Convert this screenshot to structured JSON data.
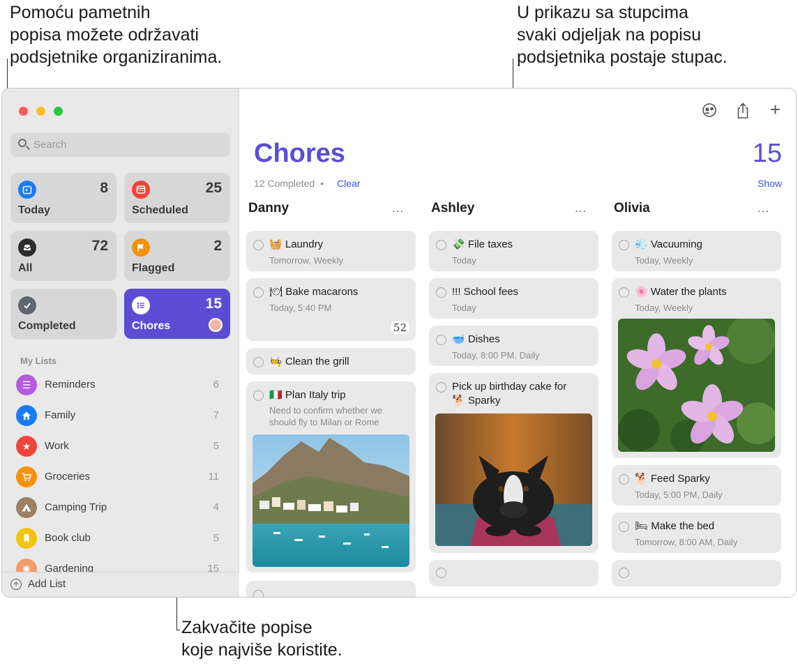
{
  "callouts": {
    "top_left": "Pomoću pametnih\npopisa možete održavati\npodsjetnike organiziranima.",
    "top_right": "U prikazu sa stupcima\nsvaki odjeljak na popisu\npodsjetnika postaje stupac.",
    "bottom": "Zakvačite popise\nkoje najviše koristite."
  },
  "sidebar": {
    "search_placeholder": "Search",
    "smart_lists": [
      {
        "label": "Today",
        "count": "8",
        "icon": "calendar-icon",
        "color": "#1a7cf5"
      },
      {
        "label": "Scheduled",
        "count": "25",
        "icon": "calendar-grid-icon",
        "color": "#f0443a"
      },
      {
        "label": "All",
        "count": "72",
        "icon": "tray-icon",
        "color": "#2c2c2e"
      },
      {
        "label": "Flagged",
        "count": "2",
        "icon": "flag-icon",
        "color": "#f5910a"
      },
      {
        "label": "Completed",
        "count": "",
        "icon": "checkmark-icon",
        "color": "#5e6670"
      },
      {
        "label": "Chores",
        "count": "15",
        "icon": "list-icon",
        "color": "#5b4dd3"
      }
    ],
    "my_lists_header": "My Lists",
    "lists": [
      {
        "name": "Reminders",
        "count": "6",
        "icon": "bullet-list-icon",
        "color": "#b45be0"
      },
      {
        "name": "Family",
        "count": "7",
        "icon": "house-icon",
        "color": "#1a7cf5"
      },
      {
        "name": "Work",
        "count": "5",
        "icon": "star-icon",
        "color": "#f0443a"
      },
      {
        "name": "Groceries",
        "count": "11",
        "icon": "cart-icon",
        "color": "#f5910a"
      },
      {
        "name": "Camping Trip",
        "count": "4",
        "icon": "tent-icon",
        "color": "#9a8262"
      },
      {
        "name": "Book club",
        "count": "5",
        "icon": "bookmark-icon",
        "color": "#f5c40a"
      },
      {
        "name": "Gardening",
        "count": "15",
        "icon": "sun-icon",
        "color": "#f29d6b"
      }
    ],
    "add_list": "Add List"
  },
  "main": {
    "title": "Chores",
    "total": "15",
    "completed_text": "12 Completed",
    "separator": "•",
    "clear": "Clear",
    "show": "Show",
    "columns": [
      {
        "name": "Danny",
        "more": "...",
        "items": [
          {
            "emoji": "🧺",
            "title": "Laundry",
            "sub": "Tomorrow, Weekly"
          },
          {
            "emoji": "🍽",
            "title": "Bake macarons",
            "sub": "Today, 5:40 PM",
            "badge": "52"
          },
          {
            "emoji": "🧑‍🍳",
            "title": "Clean the grill",
            "sub": ""
          },
          {
            "emoji": "🇮🇹",
            "title": "Plan Italy trip",
            "sub": "Need to confirm whether we should fly to Milan or Rome"
          }
        ]
      },
      {
        "name": "Ashley",
        "more": "...",
        "items": [
          {
            "emoji": "💸",
            "title": "File taxes",
            "sub": "Today"
          },
          {
            "emoji": "",
            "title": "!!! School fees",
            "sub": "Today"
          },
          {
            "emoji": "🥣",
            "title": "Dishes",
            "sub": "Today, 8:00 PM, Daily"
          },
          {
            "emoji": "🐕",
            "title": "Pick up birthday cake for",
            "title2": "Sparky",
            "sub": ""
          }
        ]
      },
      {
        "name": "Olivia",
        "more": "...",
        "items": [
          {
            "emoji": "💨",
            "title": "Vacuuming",
            "sub": "Today, Weekly"
          },
          {
            "emoji": "🌸",
            "title": "Water the plants",
            "sub": "Today, Weekly"
          },
          {
            "emoji": "🐕",
            "title": "Feed Sparky",
            "sub": "Today, 5:00 PM, Daily"
          },
          {
            "emoji": "🛏",
            "title": "Make the bed",
            "sub": "Tomorrow, 8:00 AM, Daily"
          }
        ]
      }
    ]
  }
}
